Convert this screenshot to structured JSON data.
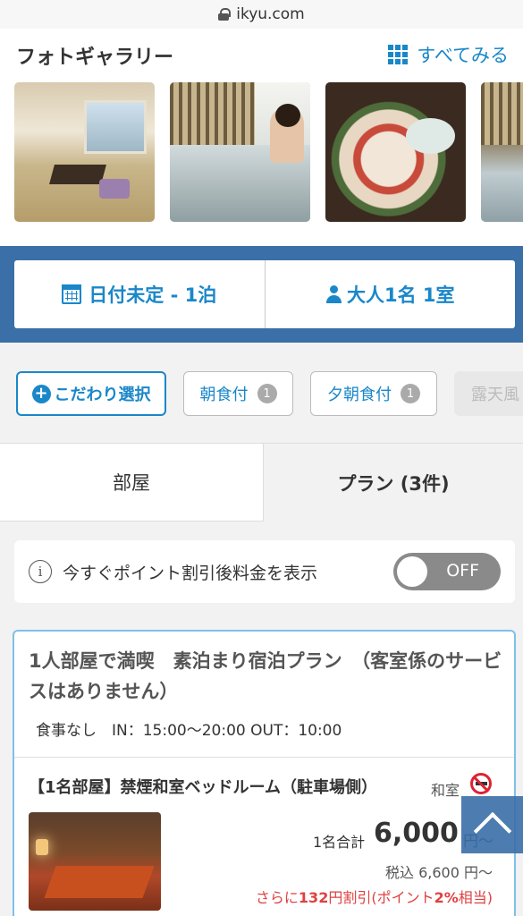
{
  "browser": {
    "url": "ikyu.com"
  },
  "gallery": {
    "title": "フォトギャラリー",
    "see_all": "すべてみる",
    "photos": [
      "guest-room",
      "open-air-bath",
      "kaiseki-meal",
      "bath-partial"
    ]
  },
  "search": {
    "date": "日付未定 - 1泊",
    "guests": "大人1名 1室"
  },
  "filters": {
    "primary": "こだわり選択",
    "chips": [
      {
        "label": "朝食付",
        "count": "1"
      },
      {
        "label": "夕朝食付",
        "count": "1"
      },
      {
        "label": "露天風"
      }
    ]
  },
  "tabs": {
    "rooms": "部屋",
    "plans": "プラン (3件)"
  },
  "point_discount": {
    "label": "今すぐポイント割引後料金を表示",
    "toggle": "OFF"
  },
  "plan": {
    "title": "1人部屋で満喫　素泊まり宿泊プラン　（客室係のサービスはありません）",
    "meta": "食事なし　IN：15:00～20:00 OUT：10:00",
    "room_name": "【1名部屋】禁煙和室ベッドルーム（駐車場側）",
    "room_type": "和室",
    "total_label": "1名合計",
    "total_price": "6,000",
    "total_unit": "円～",
    "tax_included": "税込 6,600 円～",
    "discount_prefix": "さらに",
    "discount_amount": "132",
    "discount_mid": "円割引(ポイント",
    "discount_rate": "2%",
    "discount_suffix": "相当)"
  },
  "colors": {
    "accent": "#1a87c9",
    "band": "#3a6fa8",
    "discount": "#e04040"
  }
}
